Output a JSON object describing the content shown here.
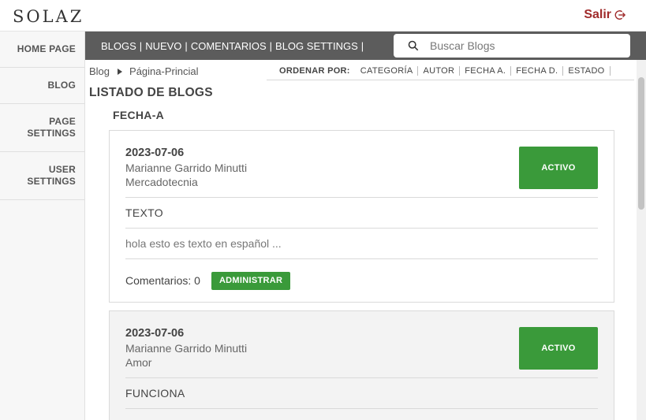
{
  "header": {
    "logo_text": "SOLAZ",
    "logout_label": "Salir"
  },
  "sidebar": {
    "items": [
      {
        "label": "HOME PAGE"
      },
      {
        "label": "BLOG"
      },
      {
        "label": "PAGE SETTINGS"
      },
      {
        "label": "USER SETTINGS"
      }
    ]
  },
  "nav": {
    "links": [
      "BLOGS",
      "NUEVO",
      "COMENTARIOS",
      "BLOG SETTINGS"
    ],
    "separator": "|",
    "search_placeholder": "Buscar Blogs"
  },
  "breadcrumb": {
    "items": [
      "Blog",
      "Página-Princial"
    ]
  },
  "sort": {
    "label": "ORDENAR POR:",
    "options": [
      "CATEGORÍA",
      "AUTOR",
      "FECHA A.",
      "FECHA D.",
      "ESTADO"
    ]
  },
  "page": {
    "title": "LISTADO DE BLOGS",
    "group_title": "FECHA-A"
  },
  "posts": [
    {
      "date": "2023-07-06",
      "author": "Marianne Garrido Minutti",
      "category": "Mercadotecnia",
      "status": "ACTIVO",
      "title": "TEXTO",
      "excerpt": "hola esto es texto en español ...",
      "comments_label": "Comentarios: 0",
      "admin_label": "ADMINISTRAR"
    },
    {
      "date": "2023-07-06",
      "author": "Marianne Garrido Minutti",
      "category": "Amor",
      "status": "ACTIVO",
      "title": "FUNCIONA"
    }
  ],
  "colors": {
    "accent_green": "#3a9a3a",
    "logout_red": "#a02b2b",
    "nav_bg": "#5c5c5c"
  },
  "icons": {
    "search": "search-icon",
    "logout": "logout-icon",
    "breadcrumb_sep": "caret-right-icon"
  }
}
